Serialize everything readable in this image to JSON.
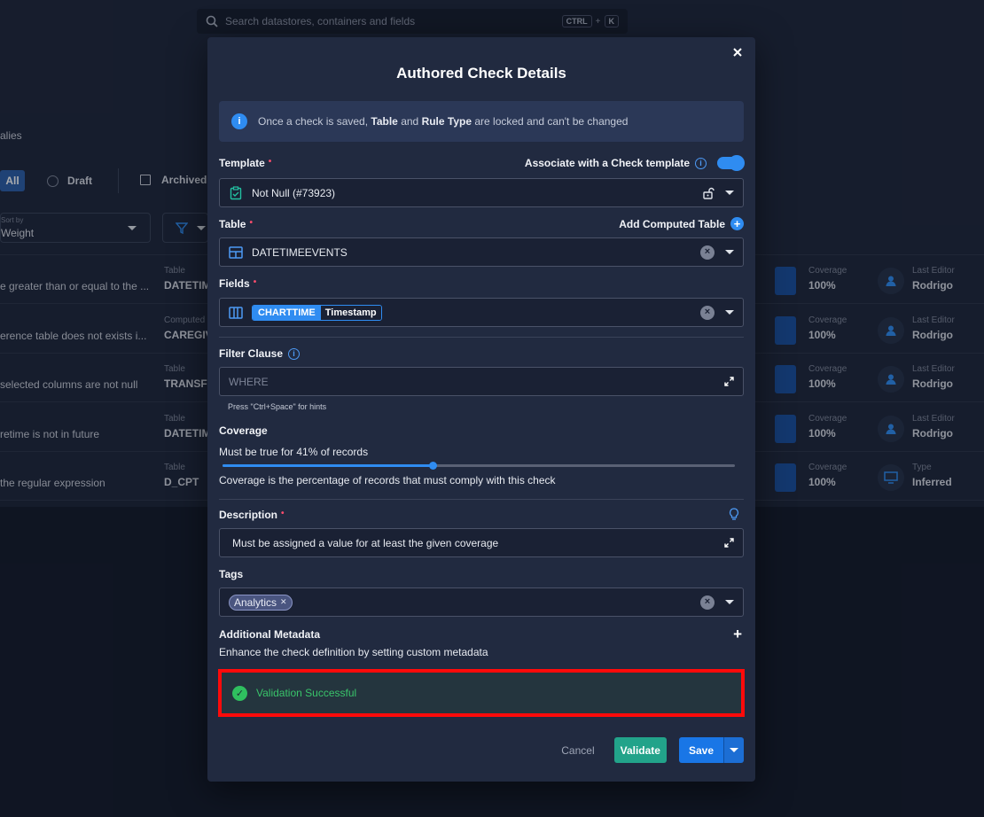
{
  "background": {
    "search": {
      "placeholder": "Search datastores, containers and fields",
      "kbd1": "CTRL",
      "plus": "+",
      "kbd2": "K"
    },
    "tab_partial": "alies",
    "filters": {
      "all": "All",
      "draft": "Draft",
      "archived": "Archived"
    },
    "sort": {
      "label": "Sort by",
      "value": "Weight"
    },
    "rows": [
      {
        "desc": "e greater than or equal to the ...",
        "type_label": "Table",
        "type_value": "DATETIMI",
        "coverage_label": "Coverage",
        "coverage_value": "100%",
        "editor_label": "Last Editor",
        "editor_value": "Rodrigo"
      },
      {
        "desc": "erence table does not exists i...",
        "type_label": "Computed",
        "type_value": "CAREGIV",
        "coverage_label": "Coverage",
        "coverage_value": "100%",
        "editor_label": "Last Editor",
        "editor_value": "Rodrigo"
      },
      {
        "desc": "selected columns are not null",
        "type_label": "Table",
        "type_value": "TRANSFE",
        "coverage_label": "Coverage",
        "coverage_value": "100%",
        "editor_label": "Last Editor",
        "editor_value": "Rodrigo"
      },
      {
        "desc": "retime is not in future",
        "type_label": "Table",
        "type_value": "DATETIMI",
        "coverage_label": "Coverage",
        "coverage_value": "100%",
        "editor_label": "Last Editor",
        "editor_value": "Rodrigo"
      },
      {
        "desc": " the regular expression",
        "type_label": "Table",
        "type_value": "D_CPT",
        "coverage_label": "Coverage",
        "coverage_value": "100%",
        "editor_label": "Type",
        "editor_value": "Inferred"
      }
    ]
  },
  "modal": {
    "title": "Authored Check Details",
    "info": {
      "prefix": "Once a check is saved, ",
      "b1": "Table",
      "mid": " and ",
      "b2": "Rule Type",
      "suffix": " are locked and can't be changed"
    },
    "template": {
      "label": "Template",
      "associate_label": "Associate with a Check template",
      "value": "Not Null (#73923)"
    },
    "table": {
      "label": "Table",
      "add_computed": "Add Computed Table",
      "value": "DATETIMEEVENTS"
    },
    "fields": {
      "label": "Fields",
      "chip_name": "CHARTTIME",
      "chip_type": "Timestamp"
    },
    "filter": {
      "label": "Filter Clause",
      "placeholder": "WHERE",
      "hint": "Press \"Ctrl+Space\" for hints"
    },
    "coverage": {
      "label": "Coverage",
      "text": "Must be true for 41% of records",
      "value": 41,
      "help": "Coverage is the percentage of records that must comply with this check"
    },
    "description": {
      "label": "Description",
      "value": "Must be assigned a value for at least the given coverage"
    },
    "tags": {
      "label": "Tags",
      "items": [
        "Analytics"
      ]
    },
    "metadata": {
      "label": "Additional Metadata",
      "help": "Enhance the check definition by setting custom metadata"
    },
    "validation": {
      "message": "Validation Successful"
    },
    "buttons": {
      "cancel": "Cancel",
      "validate": "Validate",
      "save": "Save"
    }
  },
  "colors": {
    "accent": "#2f8cf1",
    "success": "#39c46a",
    "highlight": "#ff0a0a",
    "validate": "#22a38a"
  }
}
